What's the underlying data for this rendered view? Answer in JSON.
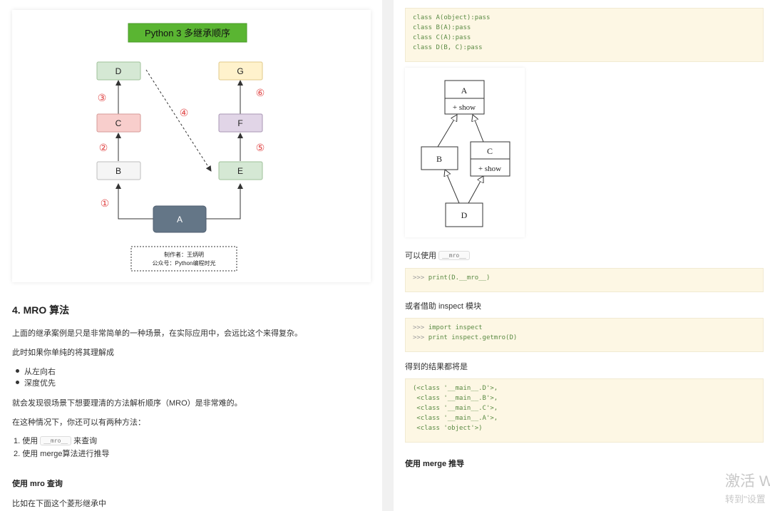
{
  "left": {
    "diagram": {
      "title": "Python 3 多继承顺序",
      "nodes": {
        "D": "D",
        "G": "G",
        "C": "C",
        "F": "F",
        "B": "B",
        "E": "E",
        "A": "A"
      },
      "steps": {
        "s1": "①",
        "s2": "②",
        "s3": "③",
        "s4": "④",
        "s5": "⑤",
        "s6": "⑥"
      },
      "author_line": "制作者：王炳明",
      "account_line": "公众号：Python编程时光",
      "colors": {
        "title_bg": "#5ab532",
        "D": "#d5e8d4",
        "G": "#fff2cc",
        "C": "#f8cecc",
        "F": "#e1d5e7",
        "B": "#f5f5f5",
        "E": "#d5e8d4",
        "A": "#647687",
        "step": "#e04444"
      }
    },
    "section_title": "4. MRO 算法",
    "p1": "上面的继承案例是只是非常简单的一种场景，在实际应用中，会远比这个来得复杂。",
    "p2": "此时如果你单纯的将其理解成",
    "bullets": [
      "从左向右",
      "深度优先"
    ],
    "p3": "就会发现很场景下想要理清的方法解析顺序（MRO）是非常难的。",
    "p4": "在这种情况下，你还可以有两种方法：",
    "list": {
      "item1_prefix": "1.  使用",
      "item1_code": "__mro__",
      "item1_suffix": "来查询",
      "item2": "2.  使用 merge算法进行推导"
    },
    "subheading": "使用 mro 查询",
    "p5": "比如在下面这个菱形继承中"
  },
  "right": {
    "code1": [
      "class A(object):pass",
      "class B(A):pass",
      "class C(A):pass",
      "class D(B, C):pass"
    ],
    "uml": {
      "A": "A",
      "A_method": "+ show",
      "B": "B",
      "C": "C",
      "C_method": "+ show",
      "D": "D"
    },
    "p_mro_prefix": "可以使用",
    "p_mro_code": "__mro__",
    "code2": {
      "prompt": ">>>",
      "text": "print(D.__mro__)"
    },
    "p_inspect": "或者借助 inspect 模块",
    "code3": [
      {
        "prompt": ">>>",
        "text": "import inspect"
      },
      {
        "prompt": ">>>",
        "text": "print inspect.getmro(D)"
      }
    ],
    "p_result": "得到的结果都将是",
    "code4": [
      "(<class '__main__.D'>,",
      " <class '__main__.B'>,",
      " <class '__main__.C'>,",
      " <class '__main__.A'>,",
      " <class 'object'>)"
    ],
    "subheading": "使用 merge 推导"
  },
  "watermark": {
    "line1": "激活 W",
    "line2": "转到\"设置"
  }
}
